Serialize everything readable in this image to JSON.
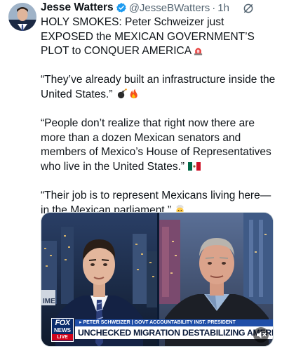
{
  "author": {
    "name": "Jesse Watters",
    "handle": "@JesseBWatters",
    "separator": "·",
    "time": "1h",
    "verified_color": "#1d9bf0"
  },
  "icons": {
    "avatar": "profile-photo",
    "verified": "verified-badge-icon",
    "grok": "grok-icon",
    "more": "more-options-icon",
    "siren": "rotating-light-emoji",
    "bomb": "bomb-emoji",
    "fire": "fire-emoji",
    "flag": "mexico-flag-emoji",
    "exploding_head": "exploding-head-emoji",
    "mute": "speaker-muted-icon"
  },
  "tweet": {
    "line1": "HOLY SMOKES: Peter Schweizer just EXPOSED the MEXICAN GOVERNMENT’S PLOT to CONQUER AMERICA",
    "line2": "“They’ve already built an infrastructure inside the United States.”",
    "line3": "“People don’t realize that right now there are more than a dozen Mexican senators and members of Mexico’s House of Representatives who live in the United States.”",
    "line4": "“Their job is to represent Mexicans living here—in the Mexican parliament.”"
  },
  "video": {
    "logo_fox": "FOX",
    "logo_news": "NEWS",
    "logo_live": "LIVE",
    "strap_top": "▸ PETER SCHWEIZER | GOVT ACCOUNTABILITY INST. PRESIDENT",
    "strap_main": "UNCHECKED MIGRATION DESTABILIZING AMERICA",
    "bg_text": "IME",
    "brand_color": "#0a2b6b",
    "accent_red": "#d0021b"
  }
}
